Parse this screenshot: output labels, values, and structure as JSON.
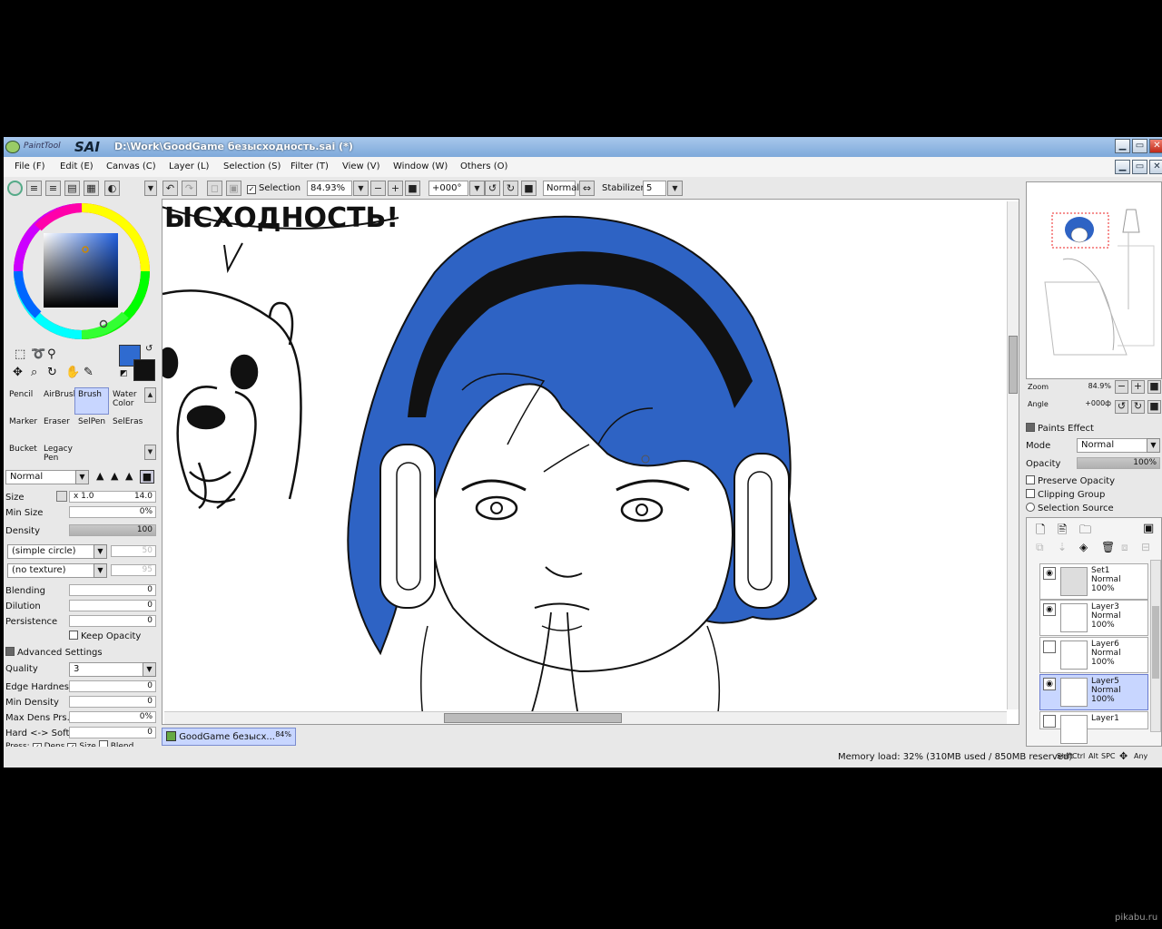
{
  "app": {
    "logo_small": "PaintTool",
    "logo_big": "SAI",
    "title": "D:\\Work\\GoodGame безысходность.sai (*)"
  },
  "menu": [
    "File (F)",
    "Edit (E)",
    "Canvas (C)",
    "Layer (L)",
    "Selection (S)",
    "Filter (T)",
    "View (V)",
    "Window (W)",
    "Others (O)"
  ],
  "toolbar": {
    "selection_label": "Selection",
    "selection_checked": true,
    "zoom": "84.93%",
    "angle": "+000°",
    "blend_mode": "Normal",
    "stabilizer_label": "Stabilizer",
    "stabilizer": "5"
  },
  "colors": {
    "primary": "#2f6bd0",
    "secondary": "#111111",
    "hair": "#2e63c4"
  },
  "tools": [
    {
      "name": "Pencil",
      "active": false
    },
    {
      "name": "AirBrush",
      "active": false
    },
    {
      "name": "Brush",
      "active": true
    },
    {
      "name": "Water Color",
      "active": false
    },
    {
      "name": "Marker",
      "active": false
    },
    {
      "name": "Eraser",
      "active": false
    },
    {
      "name": "SelPen",
      "active": false
    },
    {
      "name": "SelEras",
      "active": false
    },
    {
      "name": "Bucket",
      "active": false
    },
    {
      "name": "Legacy Pen",
      "active": false
    }
  ],
  "brush": {
    "mode": "Normal",
    "size_label": "Size",
    "size_mult": "x 1.0",
    "size": "14.0",
    "min_size_label": "Min Size",
    "min_size": "0%",
    "density_label": "Density",
    "density": "100",
    "shape": "(simple circle)",
    "shape_value": "50",
    "texture": "(no texture)",
    "texture_value": "95",
    "blending_label": "Blending",
    "blending": "0",
    "dilution_label": "Dilution",
    "dilution": "0",
    "persistence_label": "Persistence",
    "persistence": "0",
    "keep_opacity": "Keep Opacity",
    "advanced": "Advanced Settings",
    "quality_label": "Quality",
    "quality": "3",
    "edge_label": "Edge Hardness",
    "edge": "0",
    "min_density_label": "Min Density",
    "min_density": "0",
    "max_dens_label": "Max Dens Prs.",
    "max_dens": "0%",
    "hard_soft_label": "Hard <-> Soft",
    "hard_soft": "0",
    "press_label": "Press:",
    "press_dens": "Dens",
    "press_size": "Size",
    "press_blend": "Blend"
  },
  "canvas": {
    "speech_text": "ЫСХОДНОСТЬ!"
  },
  "navigator": {
    "zoom_label": "Zoom",
    "zoom": "84.9%",
    "angle_label": "Angle",
    "angle": "+000ф"
  },
  "layer_props": {
    "paint_effect": "Paints Effect",
    "mode_label": "Mode",
    "mode": "Normal",
    "opacity_label": "Opacity",
    "opacity": "100%",
    "preserve_opacity": "Preserve Opacity",
    "clipping_group": "Clipping Group",
    "selection_source": "Selection Source"
  },
  "layers": [
    {
      "name": "Set1",
      "mode": "Normal",
      "opacity": "100%",
      "visible": true,
      "folder": true
    },
    {
      "name": "Layer3",
      "mode": "Normal",
      "opacity": "100%",
      "visible": true
    },
    {
      "name": "Layer6",
      "mode": "Normal",
      "opacity": "100%",
      "visible": false
    },
    {
      "name": "Layer5",
      "mode": "Normal",
      "opacity": "100%",
      "visible": true,
      "selected": true
    },
    {
      "name": "Layer1",
      "mode": "",
      "opacity": "",
      "visible": false
    }
  ],
  "doc_tab": {
    "name": "GoodGame безысх...",
    "zoom": "84%"
  },
  "status": {
    "memory": "Memory load: 32% (310MB used / 850MB reserved)",
    "keys": [
      "Shift",
      "Ctrl",
      "Alt",
      "SPC",
      "Any"
    ]
  },
  "watermark": "pikabu.ru"
}
